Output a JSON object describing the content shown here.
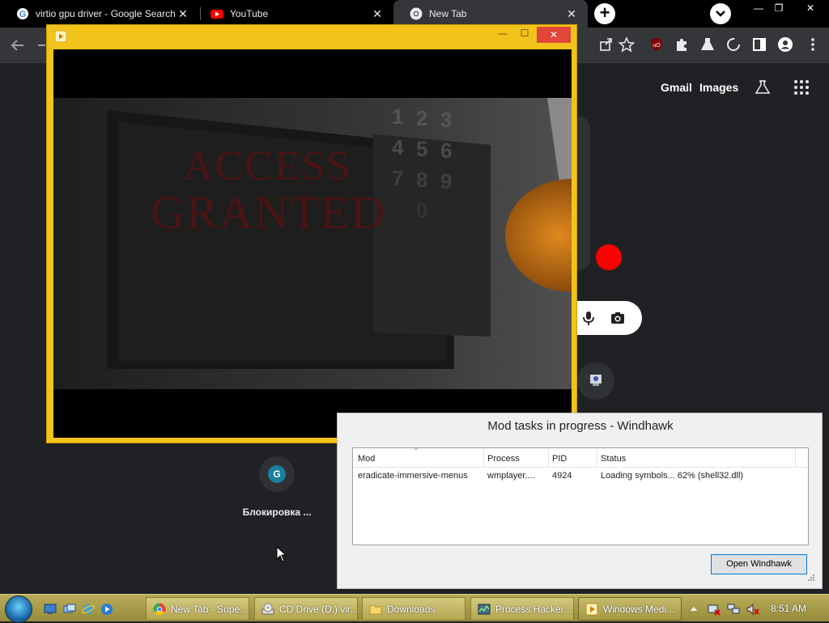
{
  "browser": {
    "tabs": [
      {
        "title": "virtio gpu driver - Google Search",
        "favicon": "google-icon"
      },
      {
        "title": "YouTube",
        "favicon": "youtube-icon"
      },
      {
        "title": "New Tab",
        "favicon": "chrome-icon"
      }
    ],
    "new_tab_label": "+",
    "close_glyph": "✕",
    "window_controls": {
      "minimize": "—",
      "restore": "❐",
      "close": "✕"
    }
  },
  "ntp": {
    "links": {
      "gmail": "Gmail",
      "images": "Images"
    },
    "shortcut": {
      "letter": "G",
      "label": "Блокировка ..."
    }
  },
  "media_player": {
    "video_text_line1": "ACCESS",
    "video_text_line2": "GRANTED",
    "keypad_digits": [
      "1",
      "2",
      "3",
      "4",
      "5",
      "6",
      "7",
      "8",
      "9",
      "0"
    ],
    "controls": {
      "minimize": "—",
      "maximize": "☐",
      "close": "✕"
    }
  },
  "windhawk": {
    "title": "Mod tasks in progress - Windhawk",
    "columns": [
      "Mod",
      "Process",
      "PID",
      "Status"
    ],
    "rows": [
      {
        "mod": "eradicate-immersive-menus",
        "process": "wmplayer....",
        "pid": "4924",
        "status": "Loading symbols... 62% (shell32.dll)"
      }
    ],
    "open_button": "Open Windhawk"
  },
  "taskbar": {
    "buttons": [
      {
        "label": "New Tab - Supe...",
        "icon": "chrome-icon"
      },
      {
        "label": "CD Drive (D:) vir...",
        "icon": "cd-drive-icon"
      },
      {
        "label": "Downloads",
        "icon": "folder-icon"
      },
      {
        "label": "Process Hacker ...",
        "icon": "process-hacker-icon"
      },
      {
        "label": "Windows Medi...",
        "icon": "media-player-icon"
      }
    ],
    "clock": "8:51 AM"
  },
  "colors": {
    "player_frame": "#f2c31a",
    "accent_blue": "#0078d7",
    "record_red": "#ff0000"
  }
}
